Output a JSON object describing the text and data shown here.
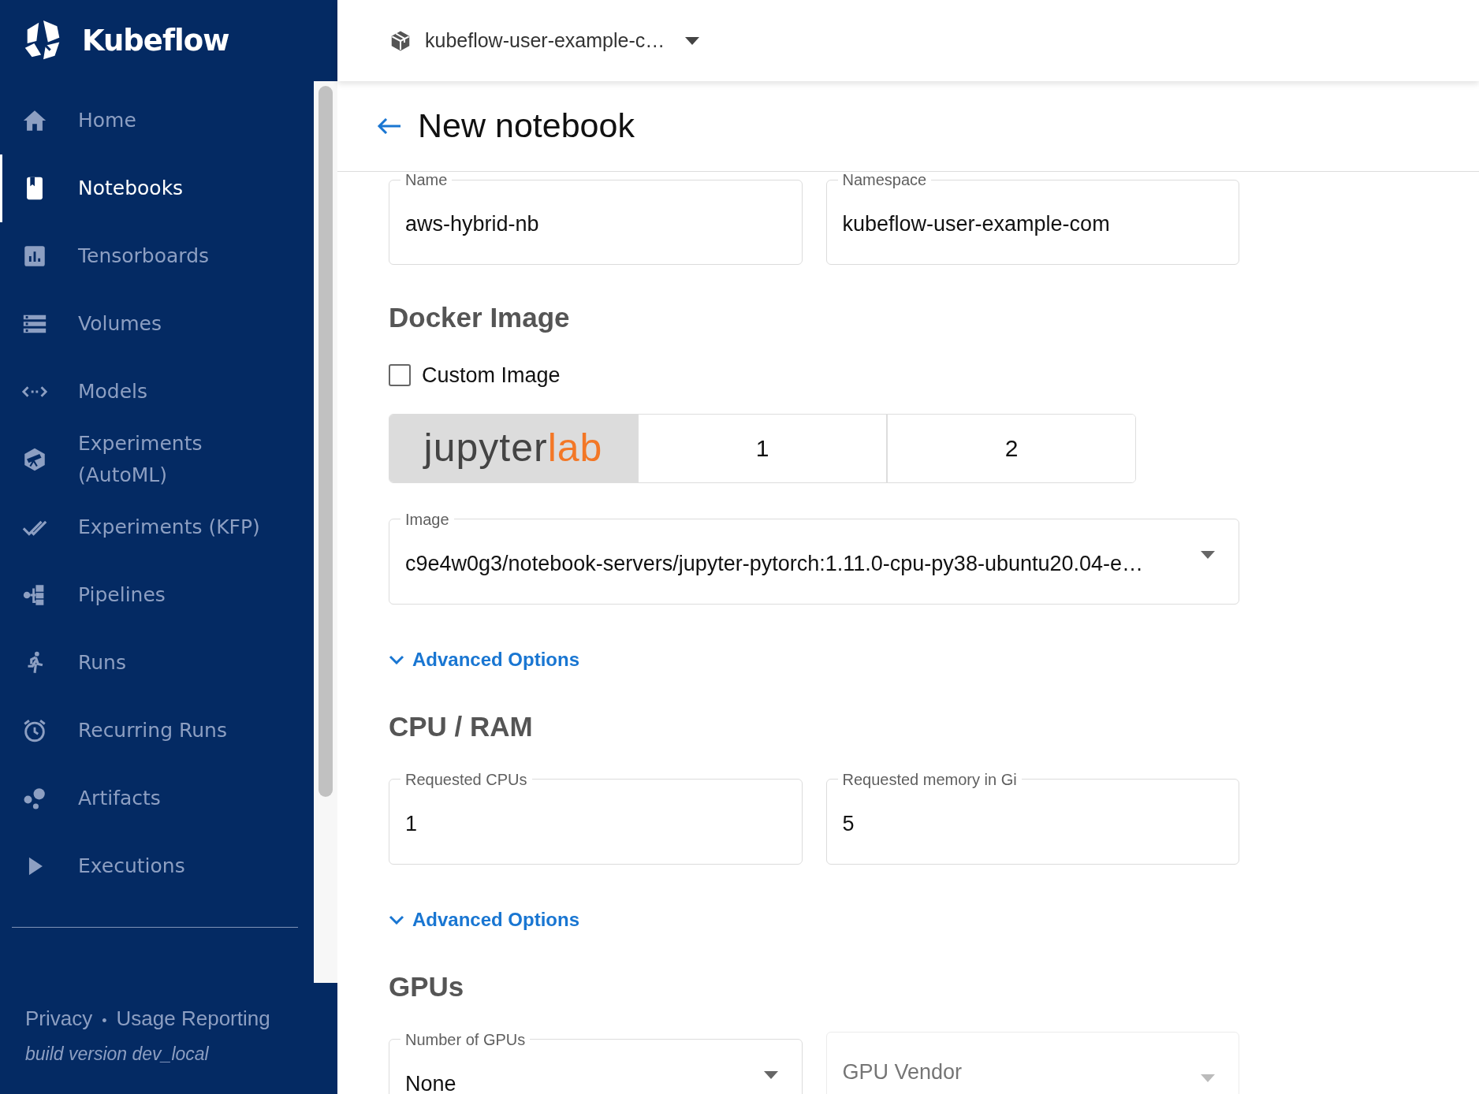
{
  "brand": {
    "name": "Kubeflow"
  },
  "sidebar": {
    "items": [
      {
        "label": "Home",
        "selected": false
      },
      {
        "label": "Notebooks",
        "selected": true
      },
      {
        "label": "Tensorboards",
        "selected": false
      },
      {
        "label": "Volumes",
        "selected": false
      },
      {
        "label": "Models",
        "selected": false
      },
      {
        "label": "Experiments (AutoML)",
        "selected": false
      },
      {
        "label": "Experiments (KFP)",
        "selected": false
      },
      {
        "label": "Pipelines",
        "selected": false
      },
      {
        "label": "Runs",
        "selected": false
      },
      {
        "label": "Recurring Runs",
        "selected": false
      },
      {
        "label": "Artifacts",
        "selected": false
      },
      {
        "label": "Executions",
        "selected": false
      }
    ]
  },
  "footer": {
    "links": [
      "Privacy",
      "Usage Reporting"
    ],
    "separator": "•",
    "build": "build version dev_local"
  },
  "topbar": {
    "namespace": "kubeflow-user-example-c…"
  },
  "page": {
    "title": "New notebook"
  },
  "name_fields": [
    {
      "label": "Name",
      "value": "aws-hybrid-nb"
    },
    {
      "label": "Namespace",
      "value": "kubeflow-user-example-com"
    }
  ],
  "docker_image": {
    "heading": "Docker Image",
    "custom_image": {
      "label": "Custom Image",
      "checked": false
    },
    "options": [
      {
        "kind": "logo",
        "label": "jupyter",
        "accent": "lab",
        "selected": true
      },
      {
        "kind": "text",
        "label": "1",
        "selected": false
      },
      {
        "kind": "text",
        "label": "2",
        "selected": false
      }
    ],
    "image": {
      "label": "Image",
      "value": "c9e4w0g3/notebook-servers/jupyter-pytorch:1.11.0-cpu-py38-ubuntu20.04-e…"
    },
    "advanced": "Advanced Options"
  },
  "cpu_ram": {
    "heading": "CPU / RAM",
    "fields": [
      {
        "label": "Requested CPUs",
        "value": "1"
      },
      {
        "label": "Requested memory in Gi",
        "value": "5"
      }
    ],
    "advanced": "Advanced Options"
  },
  "gpus": {
    "heading": "GPUs",
    "fields": [
      {
        "label": "Number of GPUs",
        "value": "None",
        "disabled": false
      },
      {
        "placeholder": "GPU Vendor",
        "disabled": true
      }
    ]
  }
}
